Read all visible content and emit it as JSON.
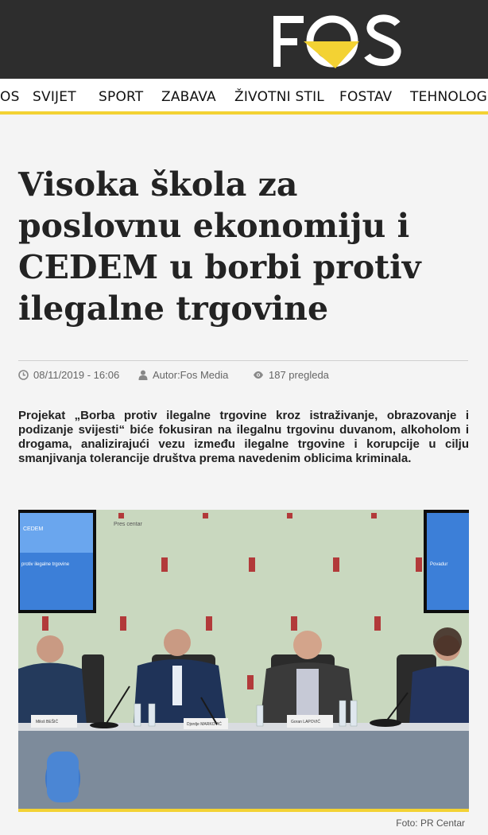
{
  "header": {
    "logo_text": "FOS",
    "accent_color": "#f3d233",
    "bg_color": "#2d2d2d"
  },
  "nav": {
    "items": [
      {
        "label": "OS"
      },
      {
        "label": "SVIJET"
      },
      {
        "label": "SPORT"
      },
      {
        "label": "ZABAVA"
      },
      {
        "label": "ŽIVOTNI STIL"
      },
      {
        "label": "FOSTAV"
      },
      {
        "label": "TEHNOLOGIJ"
      }
    ]
  },
  "article": {
    "title": "Visoka škola za poslovnu ekonomiju i CEDEM u borbi protiv ilegalne trgovine",
    "date": "08/11/2019 - 16:06",
    "author": "Autor:Fos Media",
    "views": "187 pregleda",
    "lead": "Projekat „Borba protiv ilegalne trgovine kroz istraživanje, obrazovanje i podizanje svijesti“ biće fokusiran na ilegalnu trgovinu duvanom, alkoholom i drogama, analizirajući vezu između ilegalne trgovine i korupcije u cilju smanjivanja tolerancije društva prema navedenim oblicima kriminala.",
    "photo_caption": "Foto: PR Centar",
    "icons": {
      "date": "clock-icon",
      "author": "user-icon",
      "views": "eye-icon"
    }
  },
  "photo": {
    "brand_text": "Pres centar",
    "screen_left_logo": "CEDEM",
    "screen_left_text": "protiv ilegalne trgovine",
    "screen_right_text": "Povadur",
    "nameplates": [
      "Miloš BEŠIĆ",
      "Djordje MARKOVIĆ",
      "Goran LAPOVIĆ"
    ]
  }
}
